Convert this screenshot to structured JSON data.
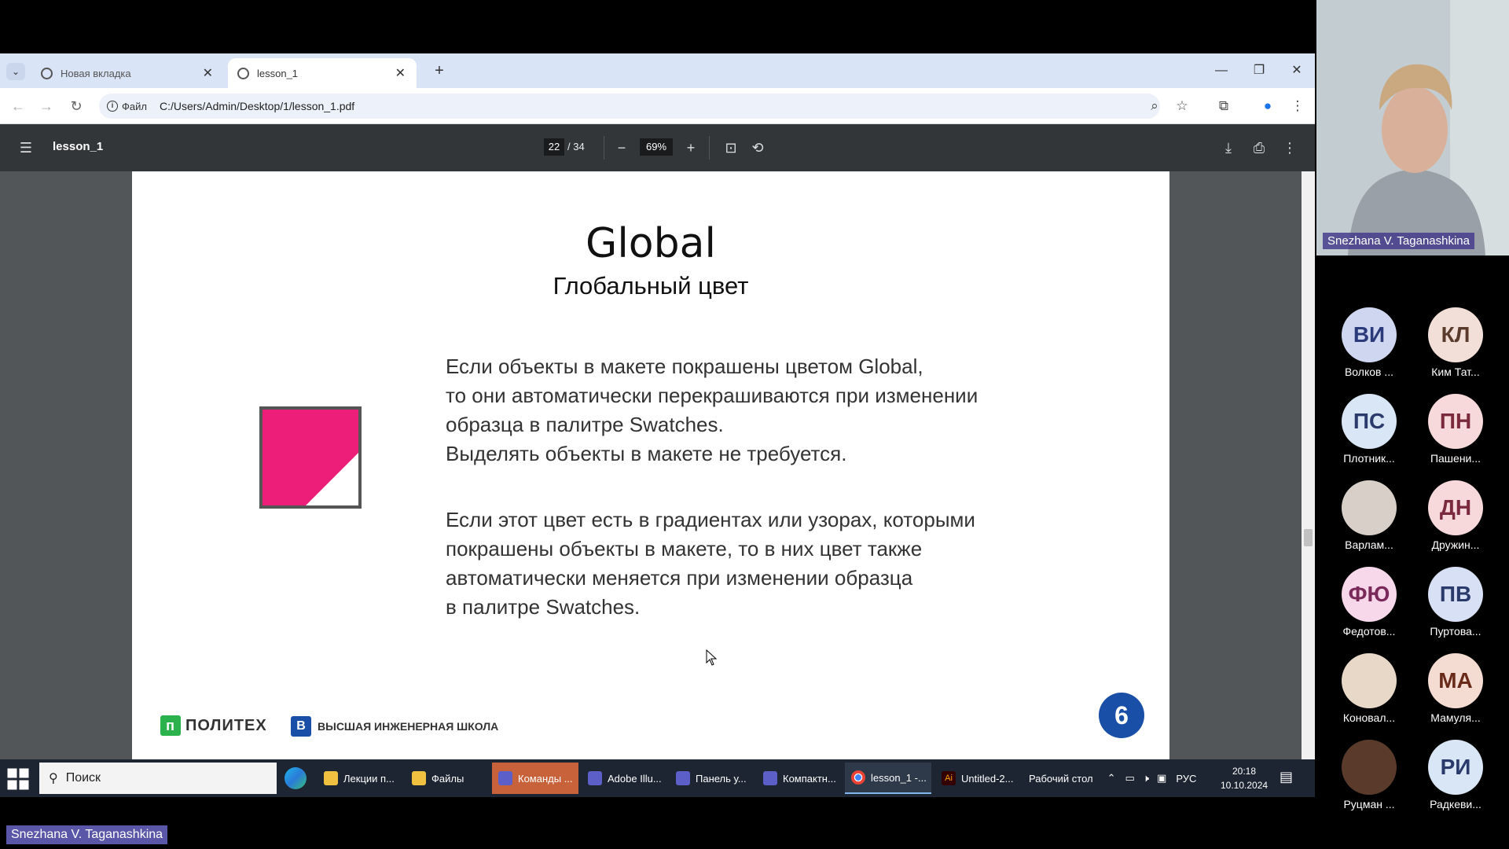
{
  "browser": {
    "tabs": [
      {
        "label": "Новая вкладка"
      },
      {
        "label": "lesson_1"
      }
    ],
    "new_tab_icon": "plus",
    "address": {
      "chip_label": "Файл",
      "url": "C:/Users/Admin/Desktop/1/lesson_1.pdf"
    }
  },
  "pdf": {
    "title": "lesson_1",
    "current_page": "22",
    "total_pages": "/ 34",
    "zoom": "69%"
  },
  "slide": {
    "title": "Global",
    "subtitle": "Глобальный цвет",
    "para1": [
      "Если объекты в макете покрашены цветом Global,",
      "то они автоматически перекрашиваются при изменении",
      "образца в палитре Swatches.",
      "Выделять объекты в макете не требуется."
    ],
    "para2": [
      "Если этот цвет есть в градиентах или узорах, которыми",
      "покрашены объекты в макете, то в них цвет также",
      "автоматически меняется при изменении образца",
      "в палитре Swatches."
    ],
    "logo1": "ПОЛИТЕХ",
    "logo1_mark": "п",
    "logo2": "ВЫСШАЯ ИНЖЕНЕРНАЯ ШКОЛА",
    "logo2_mark": "В",
    "page_number": "6",
    "swatch_color": "#ec1e79"
  },
  "taskbar": {
    "search_placeholder": "Поиск",
    "items": [
      {
        "label": "Лекции п..."
      },
      {
        "label": "Файлы"
      },
      {
        "label": "Команды ..."
      },
      {
        "label": "Adobe Illu..."
      },
      {
        "label": "Панель у..."
      },
      {
        "label": "Компактн..."
      },
      {
        "label": "lesson_1 -..."
      },
      {
        "label": "Untitled-2..."
      }
    ],
    "desktop_label": "Рабочий стол",
    "lang": "РУС",
    "time": "20:18",
    "date": "10.10.2024"
  },
  "meeting": {
    "presenter": "Snezhana V. Taganashkina",
    "participants": [
      {
        "initials": "ВИ",
        "name": "Волков ...",
        "bg": "#cfd6ef",
        "fg": "#2a3a7a"
      },
      {
        "initials": "КЛ",
        "name": "Ким Тат...",
        "bg": "#f2e0d8",
        "fg": "#5a3a2a"
      },
      {
        "initials": "ПС",
        "name": "Плотник...",
        "bg": "#d8e6f5",
        "fg": "#2a3a6a"
      },
      {
        "initials": "ПН",
        "name": "Пашени...",
        "bg": "#f7d9dc",
        "fg": "#7a2a3a"
      },
      {
        "initials": "",
        "name": "Варлам...",
        "bg": "#d8d0c8",
        "fg": "#333"
      },
      {
        "initials": "ДН",
        "name": "Дружин...",
        "bg": "#f7d9dc",
        "fg": "#7a2a3a"
      },
      {
        "initials": "ФЮ",
        "name": "Федотов...",
        "bg": "#f6d8ea",
        "fg": "#7a2a5a"
      },
      {
        "initials": "ПВ",
        "name": "Пуртова...",
        "bg": "#d8e0f5",
        "fg": "#2a3a6a"
      },
      {
        "initials": "",
        "name": "Коновал...",
        "bg": "#e8d8c8",
        "fg": "#333"
      },
      {
        "initials": "МА",
        "name": "Мамуля...",
        "bg": "#f5dcd2",
        "fg": "#6a2a1a"
      },
      {
        "initials": "",
        "name": "Руцман ...",
        "bg": "#5a3a2a",
        "fg": "#fff"
      },
      {
        "initials": "РИ",
        "name": "Радкеви...",
        "bg": "#d8e6f5",
        "fg": "#2a3a6a"
      }
    ]
  }
}
